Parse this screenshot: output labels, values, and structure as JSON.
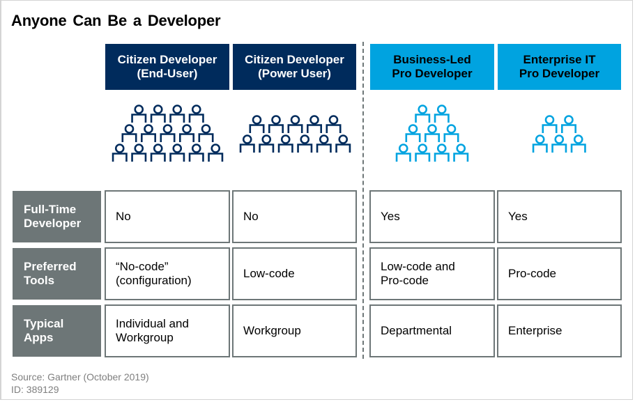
{
  "title": "Anyone Can Be a Developer",
  "colors": {
    "dark_blue": "#002b5c",
    "light_blue": "#00a3e0",
    "row_label_gray": "#6d7677",
    "cell_border": "#6d7677",
    "source_text": "#7f7f7f"
  },
  "columns": [
    {
      "label": "Citizen Developer\n(End-User)",
      "style": "dark",
      "people_rows": [
        4,
        5,
        6
      ],
      "people_icon": "person-at-desk-icon"
    },
    {
      "label": "Citizen Developer\n(Power User)",
      "style": "dark",
      "people_rows": [
        5,
        6
      ],
      "people_icon": "person-at-desk-icon"
    },
    {
      "label": "Business-Led\nPro Developer",
      "style": "light",
      "people_rows": [
        2,
        3,
        4
      ],
      "people_icon": "person-at-desk-icon"
    },
    {
      "label": "Enterprise IT\nPro Developer",
      "style": "light",
      "people_rows": [
        2,
        3
      ],
      "people_icon": "person-at-desk-icon"
    }
  ],
  "rows": [
    {
      "label": "Full-Time\nDeveloper",
      "values": [
        "No",
        "No",
        "Yes",
        "Yes"
      ]
    },
    {
      "label": "Preferred\nTools",
      "values": [
        "“No-code”\n(configuration)",
        "Low-code",
        "Low-code and\nPro-code",
        "Pro-code"
      ]
    },
    {
      "label": "Typical\nApps",
      "values": [
        "Individual and\nWorkgroup",
        "Workgroup",
        "Departmental",
        "Enterprise"
      ]
    }
  ],
  "source": {
    "line1": "Source: Gartner (October 2019)",
    "line2": "ID: 389129"
  }
}
